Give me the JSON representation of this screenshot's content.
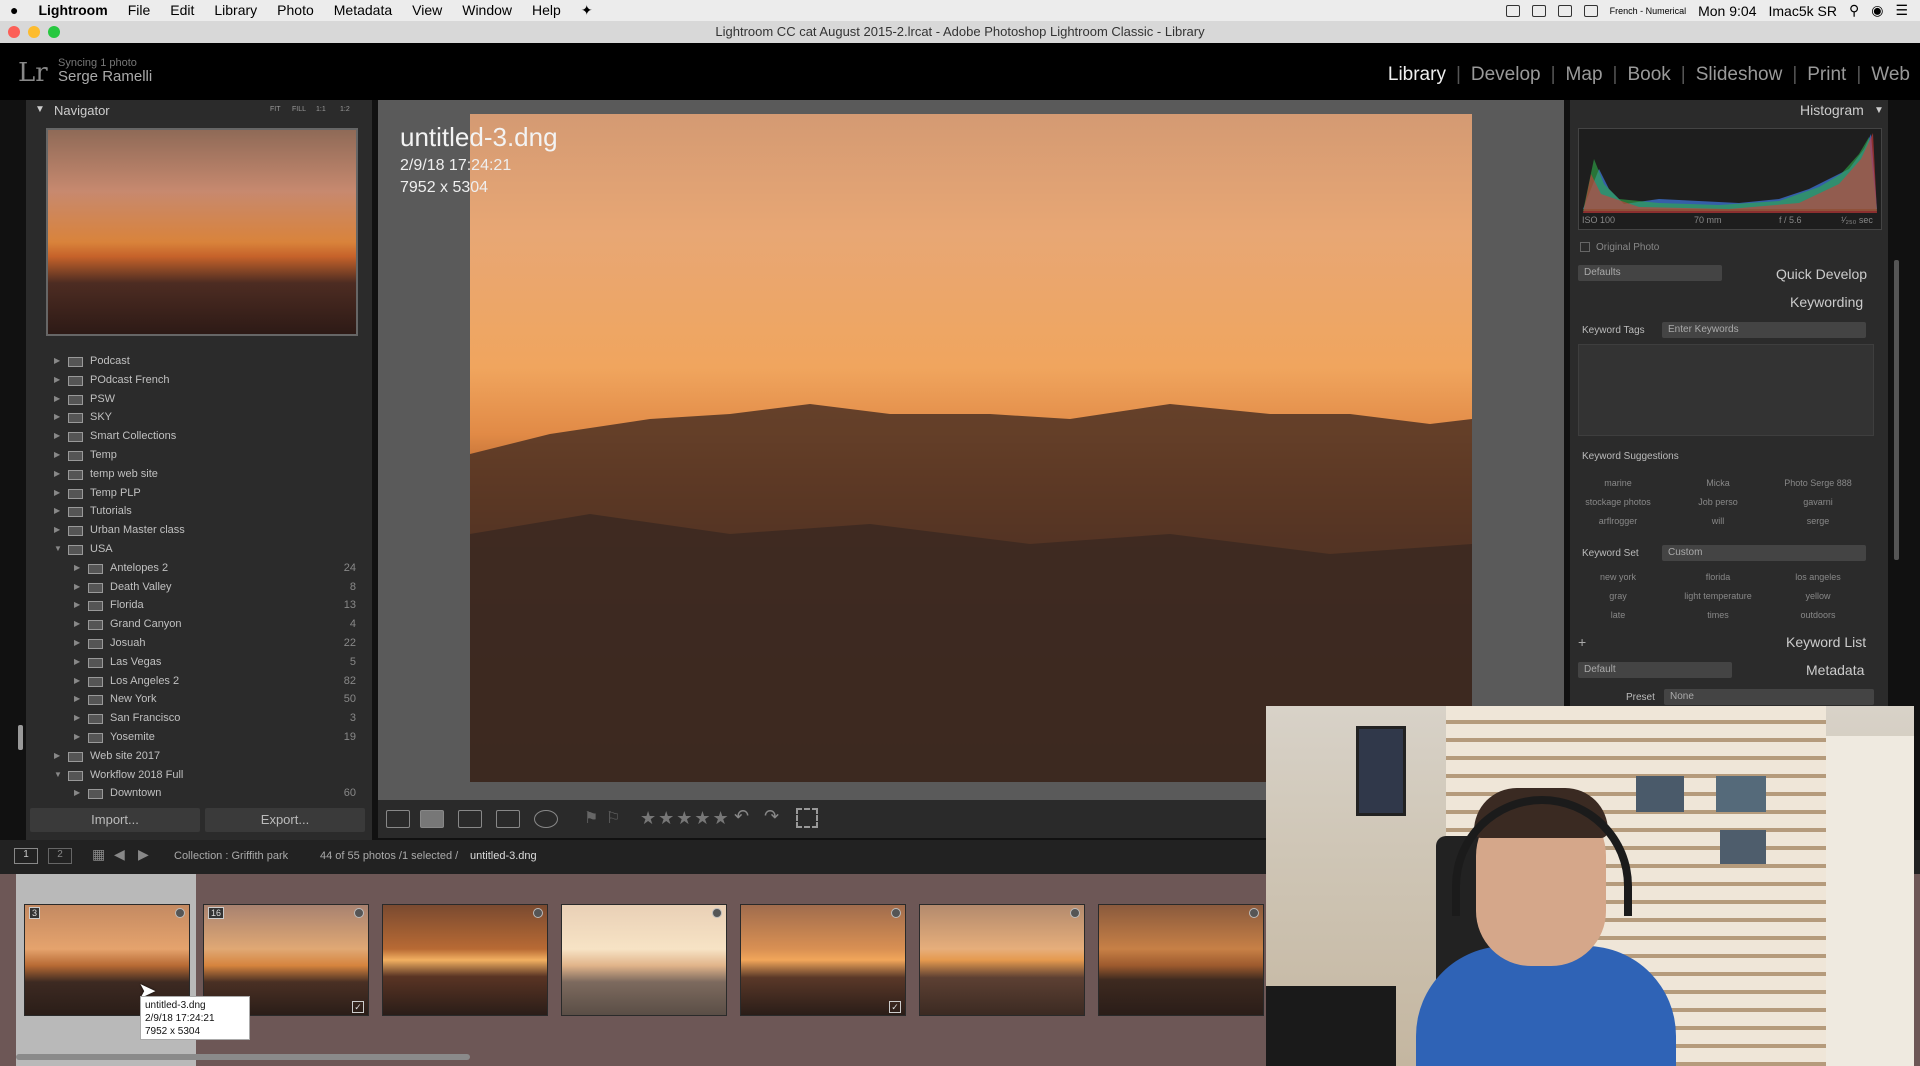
{
  "menubar": {
    "apple": "",
    "app": "Lightroom",
    "items": [
      "File",
      "Edit",
      "Library",
      "Photo",
      "Metadata",
      "View",
      "Window",
      "Help"
    ],
    "input_source": "French - Numerical",
    "clock": "Mon 9:04",
    "user": "Imac5k SR"
  },
  "window": {
    "title": "Lightroom CC cat August 2015-2.lrcat - Adobe Photoshop Lightroom Classic - Library"
  },
  "header": {
    "logo": "Lr",
    "sync": "Syncing 1 photo",
    "user": "Serge Ramelli",
    "modules": [
      "Library",
      "Develop",
      "Map",
      "Book",
      "Slideshow",
      "Print",
      "Web"
    ],
    "active": "Library"
  },
  "navigator": {
    "title": "Navigator",
    "zoom": [
      "FIT",
      "FILL",
      "1:1",
      "1:2"
    ]
  },
  "folders": [
    {
      "name": "Podcast",
      "depth": 0,
      "open": false
    },
    {
      "name": "POdcast French",
      "depth": 0,
      "open": false
    },
    {
      "name": "PSW",
      "depth": 0,
      "open": false
    },
    {
      "name": "SKY",
      "depth": 0,
      "open": false
    },
    {
      "name": "Smart Collections",
      "depth": 0,
      "open": false
    },
    {
      "name": "Temp",
      "depth": 0,
      "open": false
    },
    {
      "name": "temp web site",
      "depth": 0,
      "open": false
    },
    {
      "name": "Temp PLP",
      "depth": 0,
      "open": false
    },
    {
      "name": "Tutorials",
      "depth": 0,
      "open": false
    },
    {
      "name": "Urban Master class",
      "depth": 0,
      "open": false
    },
    {
      "name": "USA",
      "depth": 0,
      "open": true
    },
    {
      "name": "Antelopes 2",
      "depth": 1,
      "count": "24"
    },
    {
      "name": "Death Valley",
      "depth": 1,
      "count": "8"
    },
    {
      "name": "Florida",
      "depth": 1,
      "count": "13"
    },
    {
      "name": "Grand Canyon",
      "depth": 1,
      "count": "4"
    },
    {
      "name": "Josuah",
      "depth": 1,
      "count": "22"
    },
    {
      "name": "Las Vegas",
      "depth": 1,
      "count": "5"
    },
    {
      "name": "Los Angeles 2",
      "depth": 1,
      "count": "82"
    },
    {
      "name": "New York",
      "depth": 1,
      "count": "50"
    },
    {
      "name": "San Francisco",
      "depth": 1,
      "count": "3"
    },
    {
      "name": "Yosemite",
      "depth": 1,
      "count": "19"
    },
    {
      "name": "Web site 2017",
      "depth": 0,
      "open": false
    },
    {
      "name": "Workflow 2018 Full",
      "depth": 0,
      "open": true
    },
    {
      "name": "Downtown",
      "depth": 1,
      "count": "60"
    }
  ],
  "buttons": {
    "import": "Import...",
    "export": "Export..."
  },
  "loupe": {
    "filename": "untitled-3.dng",
    "date": "2/9/18 17:24:21",
    "dims": "7952 x 5304"
  },
  "histogram": {
    "title": "Histogram",
    "iso": "ISO 100",
    "focal": "70 mm",
    "aperture": "f / 5.6",
    "shutter": "¹⁄₂₅₀ sec",
    "original": "Original Photo"
  },
  "quick_develop": {
    "title": "Quick Develop",
    "preset": "Defaults"
  },
  "keywording": {
    "title": "Keywording",
    "tags_label": "Keyword Tags",
    "tags_placeholder": "Enter Keywords",
    "suggestions_title": "Keyword Suggestions",
    "suggestions": [
      "marine",
      "Micka",
      "Photo Serge 888",
      "stockage photos",
      "Job perso",
      "gavarni",
      "arflrogger",
      "will",
      "serge"
    ],
    "set_label": "Keyword Set",
    "set_value": "Custom",
    "set_words": [
      "new york",
      "florida",
      "los angeles",
      "gray",
      "light temperature",
      "yellow",
      "late",
      "times",
      "outdoors"
    ]
  },
  "keyword_list": {
    "title": "Keyword List",
    "plus": "+"
  },
  "metadata": {
    "title": "Metadata",
    "preset_select": "Default",
    "preset_label": "Preset",
    "preset_value": "None"
  },
  "filmbar": {
    "view1": "1",
    "view2": "2",
    "source": "Collection : Griffith park",
    "count": "44 of 55 photos /1 selected /",
    "selected": "untitled-3.dng"
  },
  "filmstrip": [
    {
      "badge": "3",
      "checked": false
    },
    {
      "badge": "16",
      "checked": true
    },
    {
      "badge": "",
      "checked": false
    },
    {
      "badge": "",
      "checked": false
    },
    {
      "badge": "",
      "checked": true
    },
    {
      "badge": "",
      "checked": false
    },
    {
      "badge": "",
      "checked": false
    }
  ],
  "tooltip": {
    "line1": "untitled-3.dng",
    "line2": "2/9/18 17:24:21",
    "line3": "7952 x 5304"
  },
  "colors": {
    "accent": "#eeeeee",
    "panel": "#2b2b2b"
  }
}
